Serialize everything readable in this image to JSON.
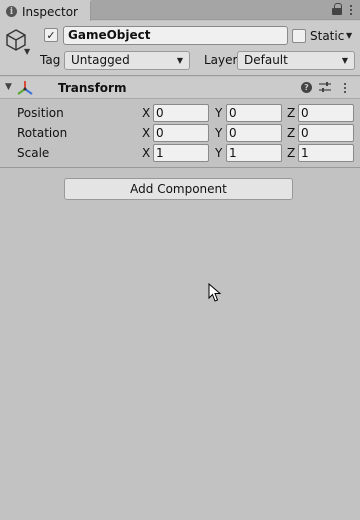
{
  "tab": {
    "title": "Inspector",
    "info_glyph": "i",
    "icons": [
      "info-icon",
      "lock-icon",
      "kebab-menu-icon"
    ]
  },
  "header": {
    "object_name": "GameObject",
    "active": true,
    "active_glyph": "✓",
    "static_label": "Static",
    "static_checked": false,
    "tag_label": "Tag",
    "tag_value": "Untagged",
    "layer_label": "Layer",
    "layer_value": "Default",
    "icons": [
      "cube-icon",
      "dropdown-arrow-icon"
    ]
  },
  "transform": {
    "title": "Transform",
    "help_glyph": "?",
    "rows": [
      {
        "label": "Position",
        "x": "0",
        "y": "0",
        "z": "0"
      },
      {
        "label": "Rotation",
        "x": "0",
        "y": "0",
        "z": "0"
      },
      {
        "label": "Scale",
        "x": "1",
        "y": "1",
        "z": "1"
      }
    ],
    "axis_labels": {
      "x": "X",
      "y": "Y",
      "z": "Z"
    },
    "icons": [
      "transform-icon",
      "help-icon",
      "presets-icon",
      "kebab-menu-icon"
    ]
  },
  "add_component_label": "Add Component",
  "colors": {
    "panel_bg": "#c2c2c2",
    "header_bg": "#cbcbcb",
    "tab_bar_bg": "#a5a5a5",
    "field_bg": "#f0f0f0",
    "button_bg": "#e4e4e4",
    "axis_red": "#d94a3a",
    "axis_green": "#5aa832",
    "axis_blue": "#3a72d9"
  }
}
